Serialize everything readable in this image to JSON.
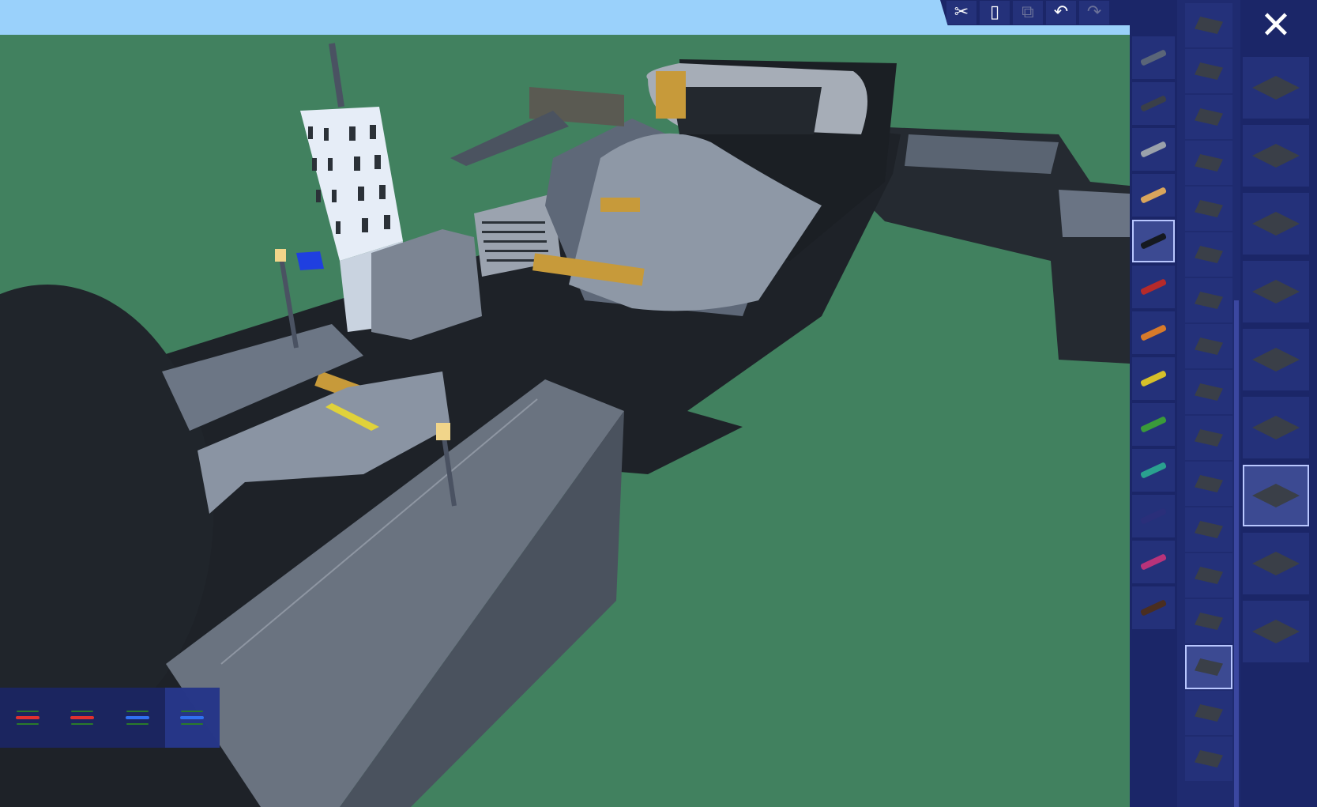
{
  "toolbar": {
    "buttons": [
      {
        "icon": "scissors-icon",
        "glyph": "✂",
        "enabled": true
      },
      {
        "icon": "copy-icon",
        "glyph": "▯",
        "enabled": true
      },
      {
        "icon": "paste-icon",
        "glyph": "⧉",
        "enabled": false
      },
      {
        "icon": "undo-icon",
        "glyph": "↶",
        "enabled": true
      },
      {
        "icon": "redo-icon",
        "glyph": "↷",
        "enabled": false
      }
    ]
  },
  "close": {
    "glyph": "✕",
    "icon": "close-icon"
  },
  "colors": {
    "selected_index": 4,
    "swatches": [
      "#5a6578",
      "#3a3f48",
      "#9aa1ab",
      "#d9a55c",
      "#151920",
      "#b52a2a",
      "#d77a2a",
      "#d6c02a",
      "#3a9a3a",
      "#2aa18f",
      "#2a2f7a",
      "#b8337a",
      "#4a2e20"
    ]
  },
  "shapes": {
    "selected_index": 14,
    "items": [
      "cone-flat-icon",
      "wedge-icon",
      "disc-icon",
      "diamond-icon",
      "dome-icon",
      "ramp-icon",
      "tilted-wedge-icon",
      "curve-icon",
      "curve-tall-icon",
      "arch-icon",
      "arch-thin-icon",
      "shield-icon",
      "small-diamond-icon",
      "spike-icon",
      "bar-icon",
      "chevron-icon",
      "arrow-icon"
    ]
  },
  "parts": {
    "selected_index": 6,
    "items": [
      "striped-plate-icon",
      "striped-plate-2-icon",
      "curved-rail-icon",
      "edged-plate-icon",
      "plate-icon",
      "thick-plate-icon",
      "curved-panel-icon",
      "lamp-post-icon",
      "hazard-strip-icon"
    ]
  },
  "gizmo": {
    "active_index": 3,
    "items": [
      "move-axis-red-icon",
      "move-axis-green-icon",
      "move-axis-blue-icon",
      "move-axis-all-icon"
    ]
  }
}
